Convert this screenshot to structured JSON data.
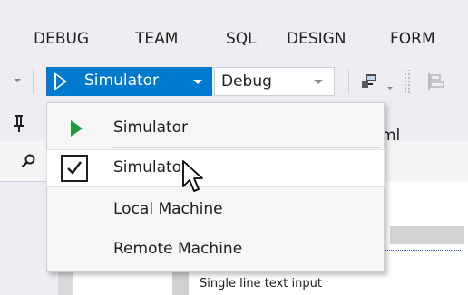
{
  "menubar": {
    "items": [
      {
        "label": "DEBUG"
      },
      {
        "label": "TEAM"
      },
      {
        "label": "SQL"
      },
      {
        "label": "DESIGN"
      },
      {
        "label": "FORM"
      }
    ]
  },
  "toolbar": {
    "run_target": "Simulator",
    "configuration": "Debug"
  },
  "document": {
    "tab_label": "ml",
    "form_row_label": "Single line text input"
  },
  "dropdown": {
    "items": [
      {
        "label": "Simulator",
        "icon": "play-icon",
        "checked": false
      },
      {
        "label": "Simulator",
        "icon": "checkmark-icon",
        "checked": true
      },
      {
        "label": "Local Machine",
        "icon": null,
        "checked": false
      },
      {
        "label": "Remote Machine",
        "icon": null,
        "checked": false
      }
    ]
  },
  "colors": {
    "accent": "#007acc",
    "play_green": "#1e9a3c",
    "chrome_bg": "#eeeef2",
    "menu_bg": "#f6f6f6"
  }
}
